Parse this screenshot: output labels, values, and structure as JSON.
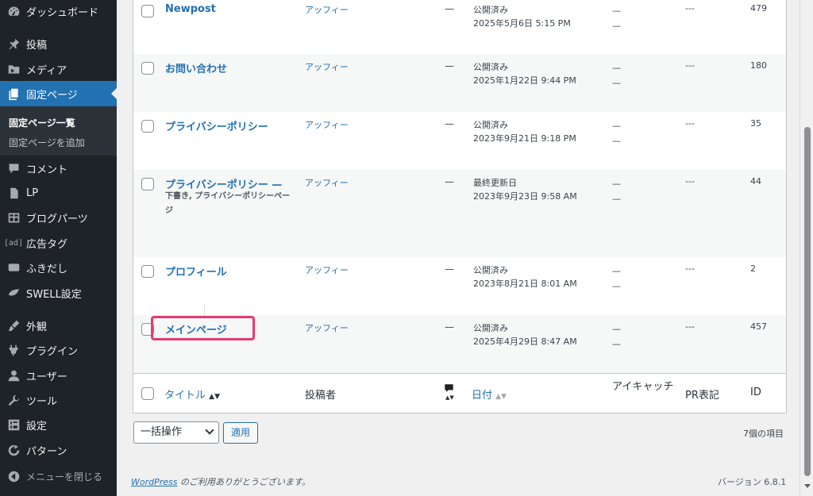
{
  "sidebar": {
    "items": [
      {
        "label": "ダッシュボード",
        "icon": "dashboard-icon"
      },
      {
        "label": "投稿",
        "icon": "pin-icon"
      },
      {
        "label": "メディア",
        "icon": "media-icon"
      },
      {
        "label": "固定ページ",
        "icon": "page-icon"
      },
      {
        "label": "コメント",
        "icon": "comment-icon"
      },
      {
        "label": "LP",
        "icon": "document-icon"
      },
      {
        "label": "ブログパーツ",
        "icon": "grid-icon"
      },
      {
        "label": "広告タグ",
        "icon": "ad-icon",
        "icon_text": "[ad]"
      },
      {
        "label": "ふきだし",
        "icon": "balloon-icon"
      },
      {
        "label": "SWELL設定",
        "icon": "swell-icon"
      },
      {
        "label": "外観",
        "icon": "brush-icon"
      },
      {
        "label": "プラグイン",
        "icon": "plugin-icon"
      },
      {
        "label": "ユーザー",
        "icon": "user-icon"
      },
      {
        "label": "ツール",
        "icon": "wrench-icon"
      },
      {
        "label": "設定",
        "icon": "settings-icon"
      },
      {
        "label": "パターン",
        "icon": "pattern-icon"
      },
      {
        "label": "メニューを閉じる",
        "icon": "collapse-icon"
      }
    ],
    "submenu": [
      {
        "label": "固定ページ一覧"
      },
      {
        "label": "固定ページを追加"
      }
    ]
  },
  "rows": [
    {
      "title": "Newpost",
      "author": "アッフィー",
      "comments": "—",
      "status": "公開済み",
      "date": "2025年5月6日 5:15 PM",
      "feat1": "—",
      "feat2": "—",
      "pr": "---",
      "id": "479"
    },
    {
      "title": "お問い合わせ",
      "author": "アッフィー",
      "comments": "—",
      "status": "公開済み",
      "date": "2025年1月22日 9:44 PM",
      "feat1": "—",
      "feat2": "—",
      "pr": "---",
      "id": "180"
    },
    {
      "title": "プライバシーポリシー",
      "author": "アッフィー",
      "comments": "—",
      "status": "公開済み",
      "date": "2023年9月21日 9:18 PM",
      "feat1": "—",
      "feat2": "—",
      "pr": "---",
      "id": "35"
    },
    {
      "title": "プライバシーポリシー —",
      "subtitle": "下書き, プライバシーポリシーページ",
      "author": "アッフィー",
      "comments": "—",
      "status": "最終更新日",
      "date": "2023年9月23日 9:58 AM",
      "feat1": "—",
      "feat2": "—",
      "pr": "---",
      "id": "44"
    },
    {
      "title": "プロフィール",
      "author": "アッフィー",
      "comments": "—",
      "status": "公開済み",
      "date": "2023年8月21日 8:01 AM",
      "feat1": "—",
      "feat2": "—",
      "pr": "---",
      "id": "2"
    },
    {
      "title": "メインページ",
      "author": "アッフィー",
      "comments": "—",
      "status": "公開済み",
      "date": "2025年4月29日 8:47 AM",
      "feat1": "—",
      "feat2": "—",
      "pr": "---",
      "id": "457"
    }
  ],
  "columns": {
    "title": "タイトル",
    "title_sort": "▲▼",
    "author": "投稿者",
    "comments_sort": "▲▼",
    "date": "日付",
    "date_sort": "▲▼",
    "featured": "アイキャッチ",
    "pr": "PR表記",
    "id": "ID"
  },
  "bulk": {
    "label": "一括操作",
    "apply": "適用",
    "count": "7個の項目"
  },
  "footer": {
    "thanks_link": "WordPress",
    "thanks_rest": " のご利用ありがとうございます。",
    "version": "バージョン 6.8.1"
  },
  "colors": {
    "accent": "#2271b1",
    "sidebar": "#1d2327",
    "highlight": "#e83a6e"
  }
}
